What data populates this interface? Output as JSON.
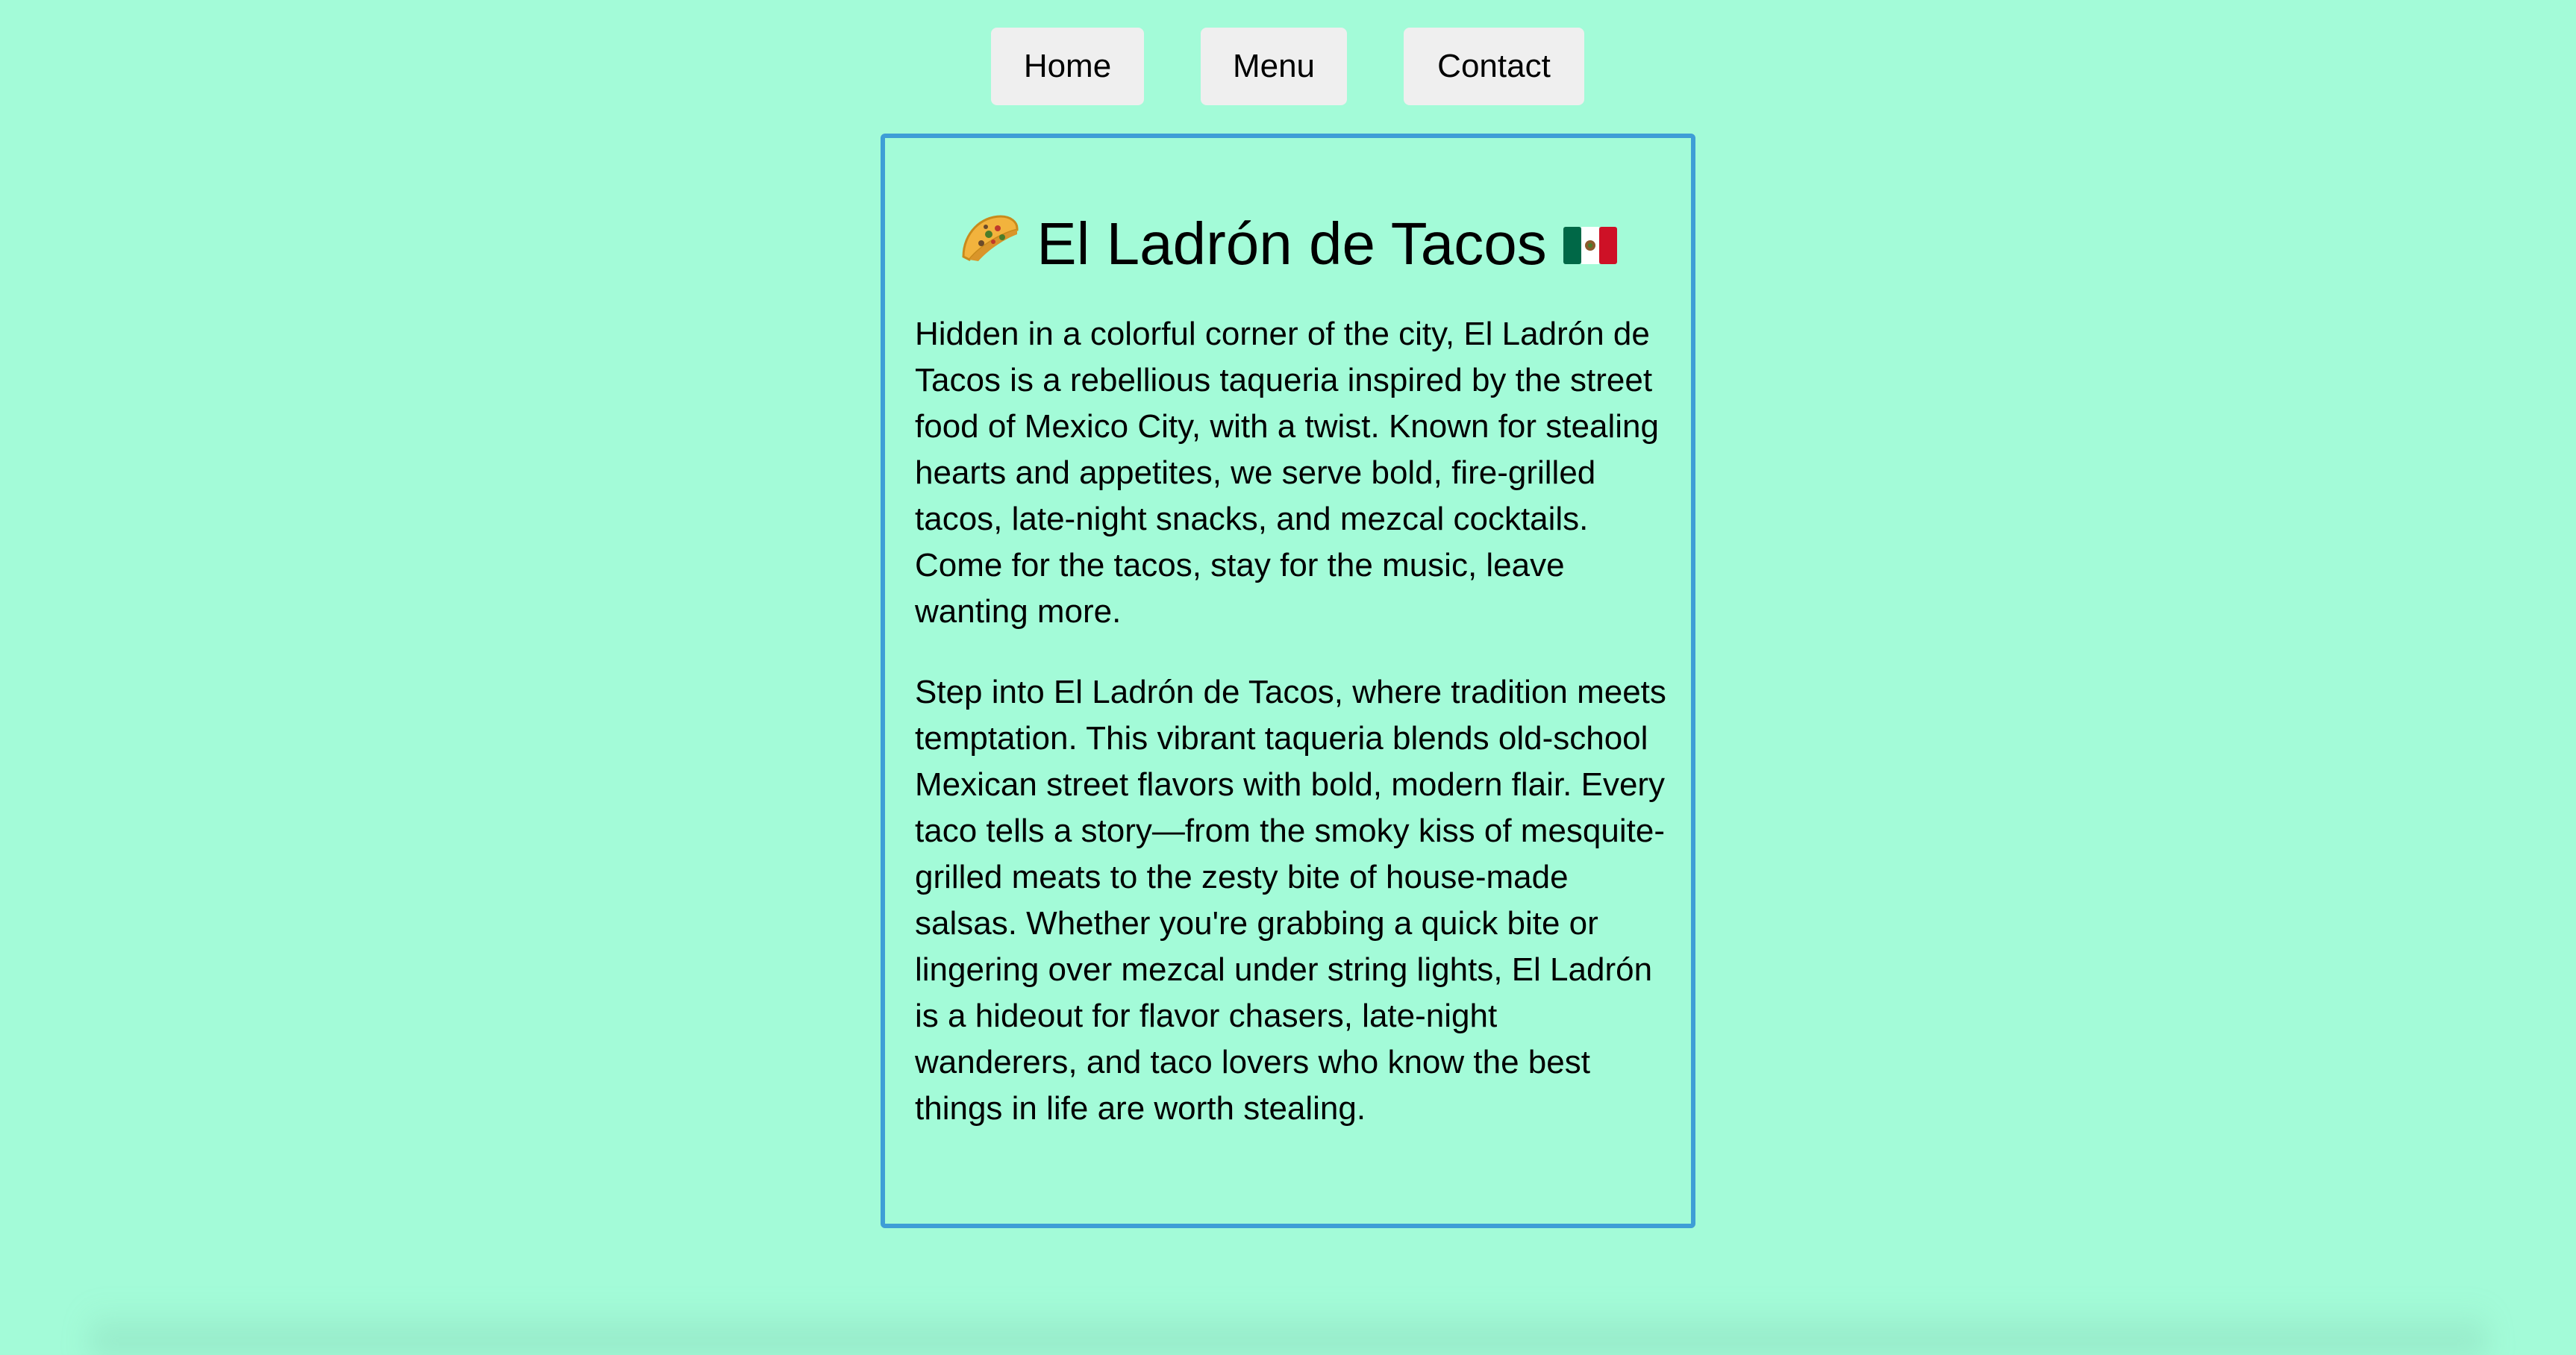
{
  "nav": {
    "items": [
      {
        "label": "Home"
      },
      {
        "label": "Menu"
      },
      {
        "label": "Contact"
      }
    ]
  },
  "card": {
    "title": "El Ladrón de Tacos",
    "title_icons": [
      "taco-icon",
      "mexico-flag-icon"
    ],
    "paragraphs": [
      "Hidden in a colorful corner of the city, El Ladrón de Tacos is a rebellious taqueria inspired by the street food of Mexico City, with a twist. Known for stealing hearts and appetites, we serve bold, fire-grilled tacos, late-night snacks, and mezcal cocktails. Come for the tacos, stay for the music, leave wanting more.",
      "Step into El Ladrón de Tacos, where tradition meets temptation. This vibrant taqueria blends old-school Mexican street flavors with bold, modern flair. Every taco tells a story—from the smoky kiss of mesquite-grilled meats to the zesty bite of house-made salsas. Whether you're grabbing a quick bite or lingering over mezcal under string lights, El Ladrón is a hideout for flavor chasers, late-night wanderers, and taco lovers who know the best things in life are worth stealing."
    ]
  },
  "colors": {
    "background": "#a3fbd8",
    "card_border": "#3e9ed6",
    "button_bg": "#efefef",
    "text": "#000000"
  }
}
